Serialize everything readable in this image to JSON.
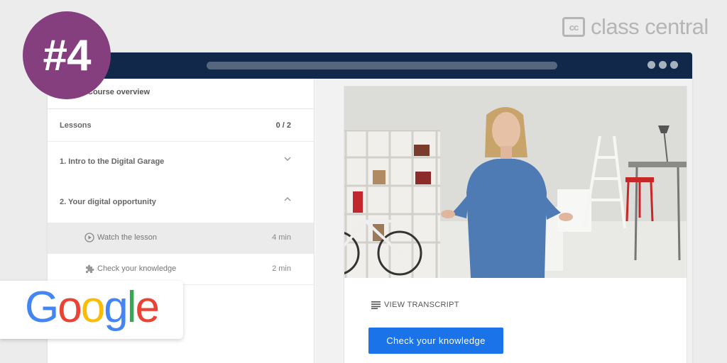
{
  "brand": {
    "class_central": "class central",
    "cc_mark": "cc",
    "badge": "#4",
    "google_letters": [
      "G",
      "o",
      "o",
      "g",
      "l",
      "e"
    ]
  },
  "sidebar": {
    "overview": "Course overview",
    "lessons_label": "Lessons",
    "lessons_progress": "0 / 2",
    "modules": [
      {
        "title": "1. Intro to the Digital Garage",
        "state": "collapsed"
      },
      {
        "title": "2. Your digital opportunity",
        "state": "expanded"
      }
    ],
    "lessons": [
      {
        "title": "Watch the lesson",
        "duration": "4 min",
        "icon": "play-circle-icon",
        "active": true
      },
      {
        "title": "Check your knowledge",
        "duration": "2 min",
        "icon": "puzzle-icon",
        "active": false
      }
    ]
  },
  "main": {
    "transcript_label": "VIEW TRANSCRIPT",
    "cta_label": "Check your knowledge"
  },
  "colors": {
    "titlebar": "#12284a",
    "badge": "#853f7f",
    "cta": "#1a73e8"
  }
}
